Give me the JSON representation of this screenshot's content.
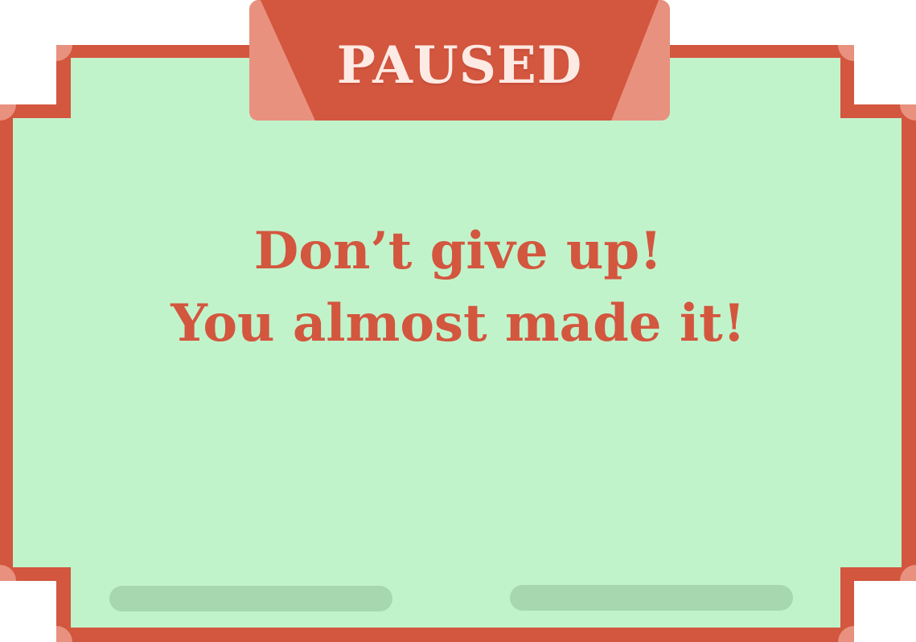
{
  "dialog": {
    "banner_title": "PAUSED",
    "message_line1": "Don’t give up!",
    "message_line2": "You almost made it!"
  },
  "colors": {
    "frame": "#d3563e",
    "frame_corner": "#e8917f",
    "panel_fill": "#c1f3cb",
    "banner_side": "#e8917f",
    "banner_text": "#fdeae4",
    "message_text": "#d3563e",
    "button_slot": "#a7d7ae"
  },
  "icons": {
    "corner_caps": "rounded-corner-cap"
  }
}
